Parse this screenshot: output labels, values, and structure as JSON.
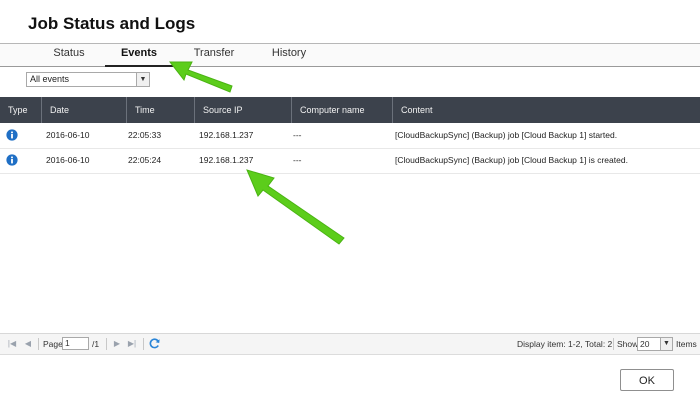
{
  "dialog": {
    "title": "Job Status and Logs"
  },
  "tabs": [
    {
      "label": "Status",
      "active": false
    },
    {
      "label": "Events",
      "active": true
    },
    {
      "label": "Transfer",
      "active": false
    },
    {
      "label": "History",
      "active": false
    }
  ],
  "filter": {
    "selected": "All events"
  },
  "table": {
    "columns": [
      "Type",
      "Date",
      "Time",
      "Source IP",
      "Computer name",
      "Content"
    ],
    "rows": [
      {
        "type_icon": "info-icon",
        "date": "2016-06-10",
        "time": "22:05:33",
        "source_ip": "192.168.1.237",
        "computer_name": "---",
        "content": "[CloudBackupSync] (Backup) job [Cloud Backup 1] started."
      },
      {
        "type_icon": "info-icon",
        "date": "2016-06-10",
        "time": "22:05:24",
        "source_ip": "192.168.1.237",
        "computer_name": "---",
        "content": "[CloudBackupSync] (Backup) job [Cloud Backup 1] is created."
      }
    ]
  },
  "pager": {
    "page_label": "Page",
    "page_value": "1",
    "page_total": "/1",
    "display_info": "Display item: 1-2, Total: 2",
    "show_label": "Show",
    "show_value": "20",
    "items_label": "Items"
  },
  "footer": {
    "ok_label": "OK"
  },
  "colors": {
    "header_bg": "#3c424c",
    "info_blue": "#1f6fc5",
    "annotation_arrow": "#5ccd1b"
  }
}
